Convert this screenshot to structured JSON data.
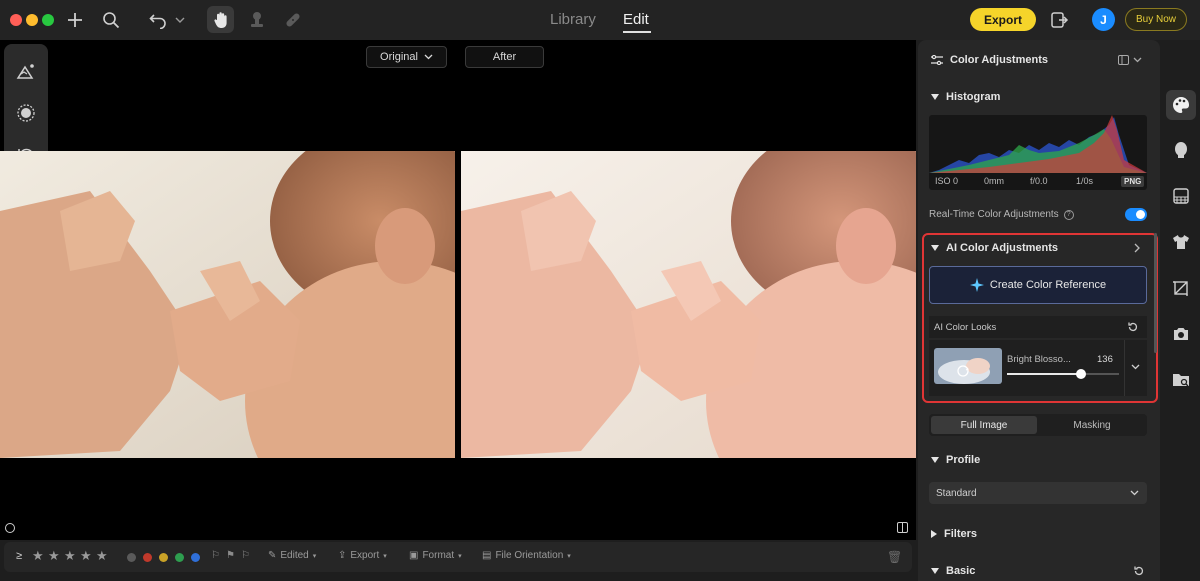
{
  "topbar": {
    "tabs": [
      {
        "label": "Library",
        "active": false
      },
      {
        "label": "Edit",
        "active": true
      }
    ],
    "export_label": "Export",
    "avatar_initial": "J",
    "buy_label": "Buy Now",
    "icons": [
      "plus-icon",
      "search-icon",
      "undo-icon",
      "chevron-down-icon",
      "hand-icon",
      "stamp-icon",
      "bandage-icon",
      "sidebar-toggle-icon"
    ]
  },
  "canvas": {
    "view_original": "Original",
    "view_after": "After",
    "left_tools": [
      "landscape-sparkle-icon",
      "radial-icon",
      "history-icon"
    ]
  },
  "bottombar": {
    "stars": 5,
    "color_labels": [
      "#5a5a5a",
      "#c0392b",
      "#c9a227",
      "#2e9e4f",
      "#2f6fd8"
    ],
    "edited_label": "Edited",
    "export_label": "Export",
    "format_label": "Format",
    "orientation_label": "File Orientation"
  },
  "panel": {
    "title": "Color Adjustments",
    "histogram": {
      "title": "Histogram",
      "iso": "ISO 0",
      "focal": "0mm",
      "aperture": "f/0.0",
      "shutter": "1/0s",
      "format": "PNG"
    },
    "realtime_label": "Real-Time Color Adjustments",
    "realtime_on": true,
    "ai": {
      "title": "AI Color Adjustments",
      "create_label": "Create Color Reference",
      "looks_label": "AI Color Looks",
      "look_name": "Bright Blosso...",
      "look_value": "136",
      "look_fraction": 0.66
    },
    "segment": {
      "full": "Full Image",
      "masking": "Masking",
      "active": "full"
    },
    "profile": {
      "title": "Profile",
      "value": "Standard"
    },
    "filters_title": "Filters",
    "basic_title": "Basic"
  },
  "right_icons": [
    "palette-icon",
    "portrait-icon",
    "background-icon",
    "shirt-icon",
    "crop-icon",
    "camera-icon",
    "folder-search-icon"
  ],
  "colors": {
    "accent": "#1a8cff",
    "export": "#f5d42a",
    "highlight": "#e03535"
  }
}
